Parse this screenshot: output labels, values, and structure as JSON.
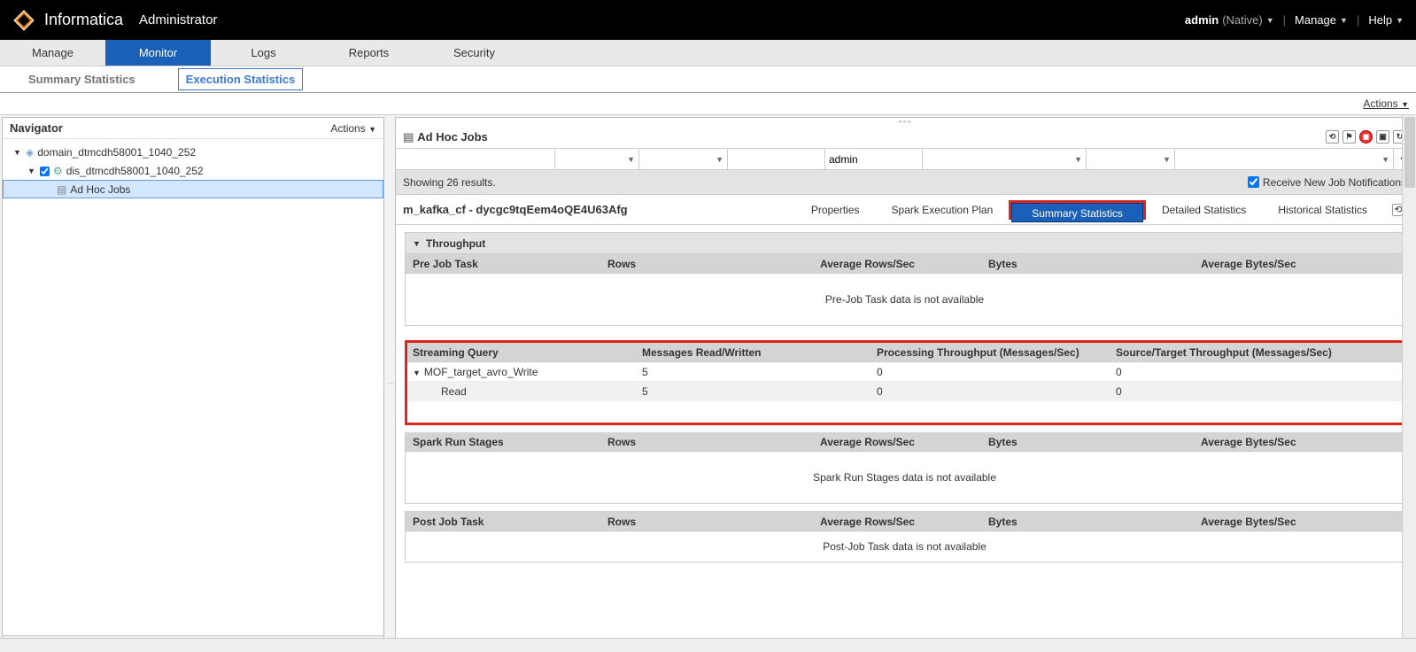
{
  "header": {
    "brand": "Informatica",
    "role": "Administrator",
    "user": "admin",
    "user_native": "(Native)",
    "manage": "Manage",
    "help": "Help"
  },
  "tabs": {
    "manage": "Manage",
    "monitor": "Monitor",
    "logs": "Logs",
    "reports": "Reports",
    "security": "Security"
  },
  "subtabs": {
    "summary": "Summary Statistics",
    "execution": "Execution Statistics"
  },
  "actions_label": "Actions",
  "navigator": {
    "title": "Navigator",
    "actions": "Actions",
    "domain": "domain_dtmcdh58001_1040_252",
    "service": "dis_dtmcdh58001_1040_252",
    "adhoc": "Ad Hoc Jobs"
  },
  "content": {
    "title": "Ad Hoc Jobs",
    "filter_user": "admin",
    "results": "Showing 26 results.",
    "receive": "Receive New Job Notifications",
    "job_title": "m_kafka_cf - dycgc9tqEem4oQE4U63Afg",
    "jtabs": {
      "properties": "Properties",
      "spark": "Spark Execution Plan",
      "summary": "Summary Statistics",
      "detailed": "Detailed Statistics",
      "historical": "Historical Statistics"
    }
  },
  "throughput_section": {
    "title": "Throughput",
    "cols": {
      "c1": "Pre Job Task",
      "c2": "Rows",
      "c3": "Average Rows/Sec",
      "c4": "Bytes",
      "c5": "Average Bytes/Sec"
    },
    "msg": "Pre-Job Task data is not available"
  },
  "streaming": {
    "cols": {
      "c1": "Streaming Query",
      "c2": "Messages Read/Written",
      "c3": "Processing Throughput (Messages/Sec)",
      "c4": "Source/Target Throughput (Messages/Sec)"
    },
    "row1": {
      "name": "MOF_target_avro_Write",
      "v2": "5",
      "v3": "0",
      "v4": "0"
    },
    "row2": {
      "name": "Read",
      "v2": "5",
      "v3": "0",
      "v4": "0"
    }
  },
  "spark_section": {
    "cols": {
      "c1": "Spark Run Stages",
      "c2": "Rows",
      "c3": "Average Rows/Sec",
      "c4": "Bytes",
      "c5": "Average Bytes/Sec"
    },
    "msg": "Spark Run Stages data is not available"
  },
  "post_section": {
    "cols": {
      "c1": "Post Job Task",
      "c2": "Rows",
      "c3": "Average Rows/Sec",
      "c4": "Bytes",
      "c5": "Average Bytes/Sec"
    },
    "msg": "Post-Job Task data is not available"
  }
}
